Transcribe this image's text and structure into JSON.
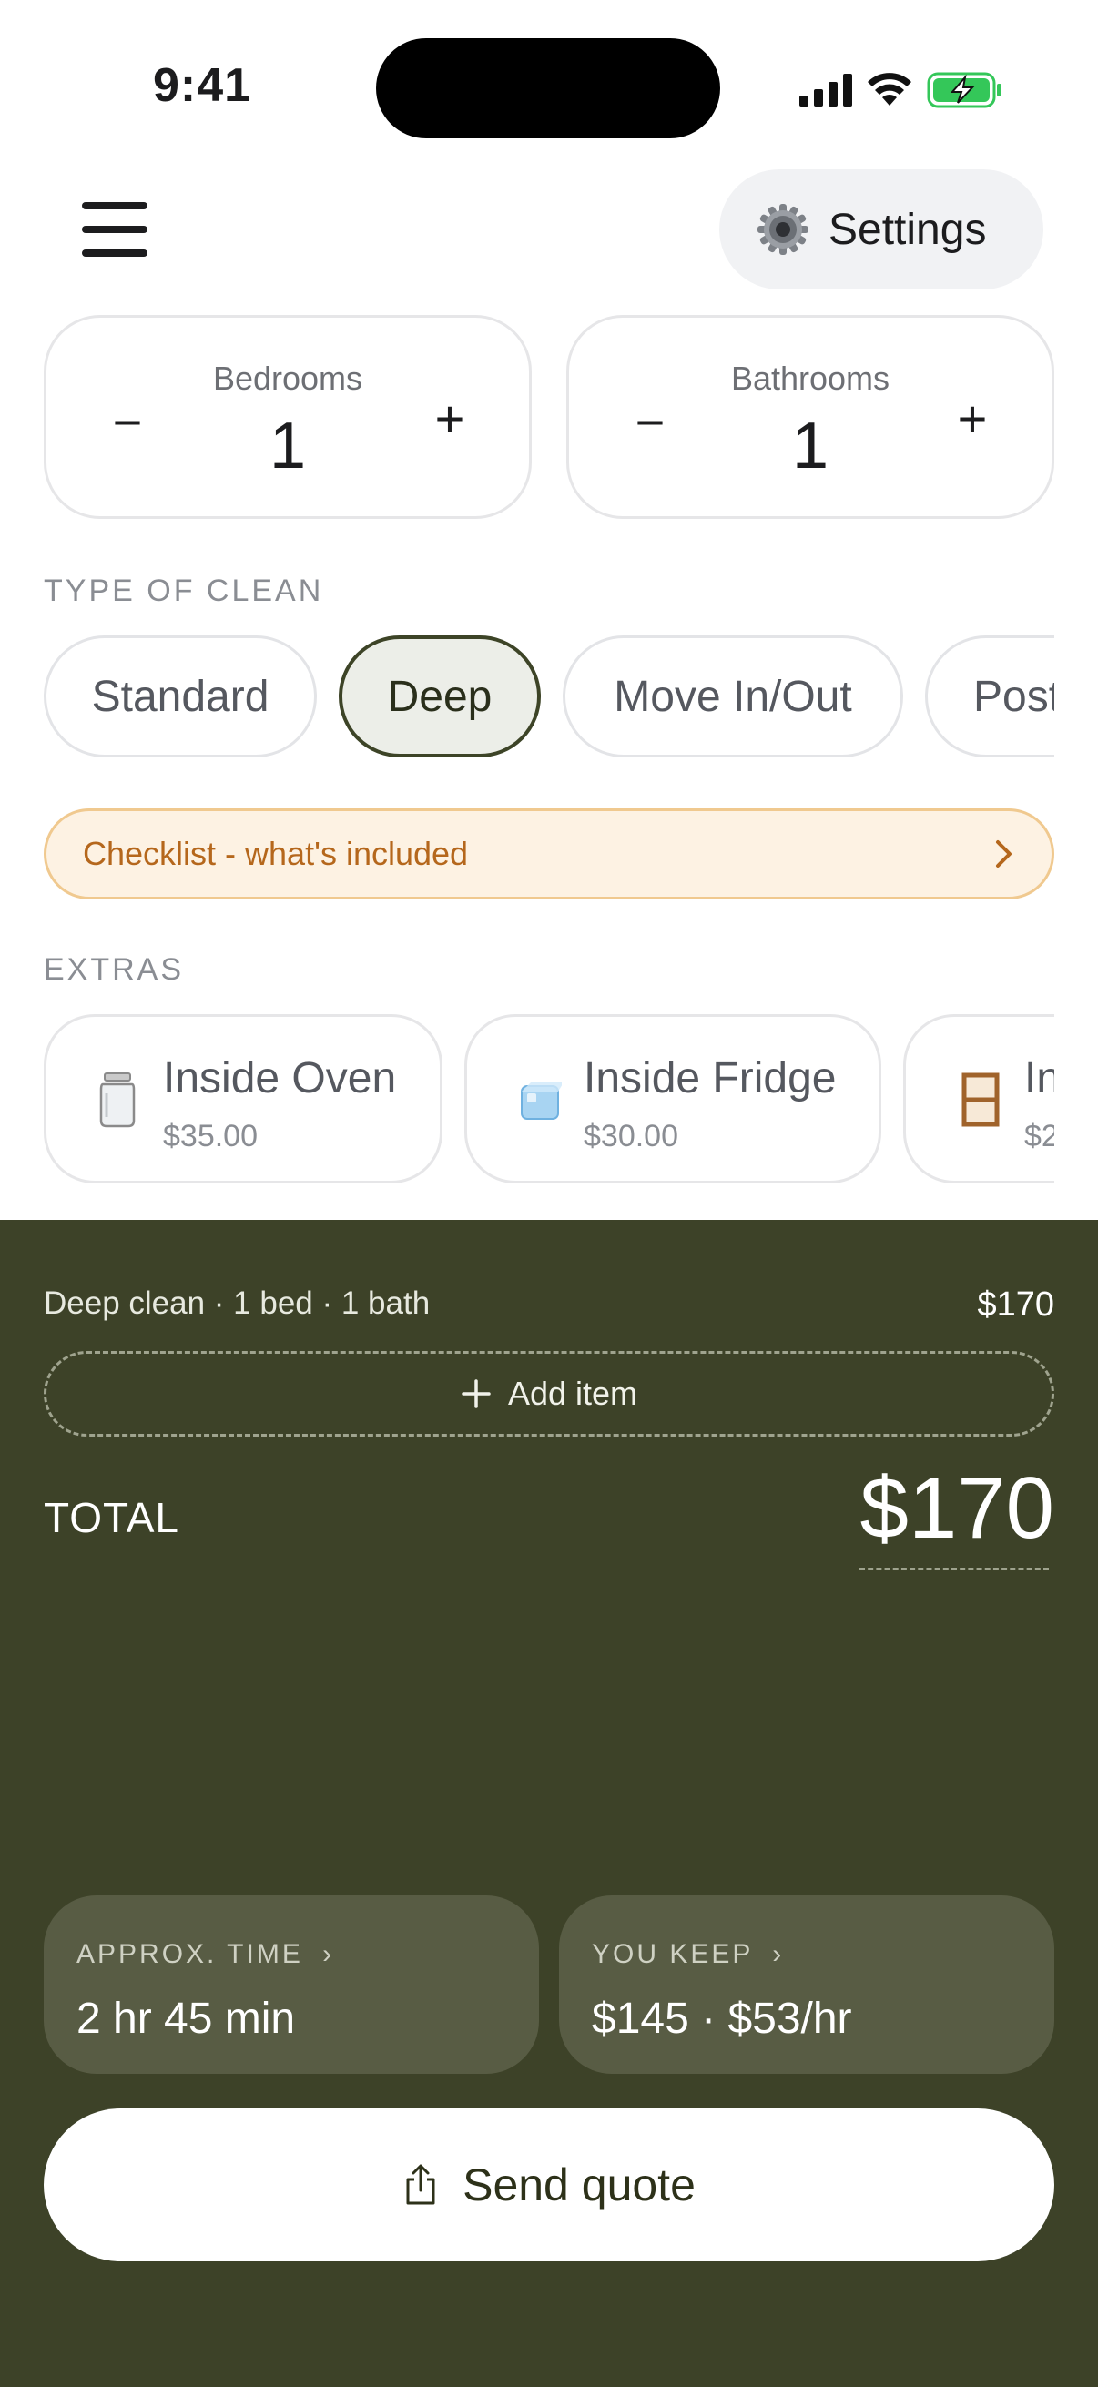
{
  "status_bar": {
    "time": "9:41",
    "battery_color": "#34c759"
  },
  "header": {
    "menu_icon": "hamburger-icon",
    "settings_label": "Settings",
    "settings_icon": "gear-icon"
  },
  "steppers": {
    "bedrooms": {
      "label": "Bedrooms",
      "value": "1",
      "minus": "−",
      "plus": "+"
    },
    "bathrooms": {
      "label": "Bathrooms",
      "value": "1",
      "minus": "−",
      "plus": "+"
    }
  },
  "clean_type": {
    "title": "TYPE OF CLEAN",
    "options": [
      "Standard",
      "Deep",
      "Move In/Out",
      "Post"
    ],
    "selected": "Deep"
  },
  "checklist": {
    "label": "Checklist - what's included",
    "chevron": "›"
  },
  "extras": {
    "title": "EXTRAS",
    "items": [
      {
        "name": "Inside Oven",
        "price": "$35.00",
        "icon": "jar-icon"
      },
      {
        "name": "Inside Fridge",
        "price": "$30.00",
        "icon": "ice-cube-icon"
      },
      {
        "name": "In",
        "price": "$2",
        "icon": "window-icon"
      }
    ]
  },
  "summary": {
    "line_item": "Deep clean · 1 bed · 1 bath",
    "line_price": "$170",
    "add_item_label": "Add item",
    "total_label": "TOTAL",
    "total_value": "$170",
    "time_title": "APPROX. TIME",
    "time_value": "2 hr 45 min",
    "keep_title": "YOU KEEP",
    "keep_value": "$145 · $53/hr",
    "stat_chevron": "›",
    "send_label": "Send quote"
  },
  "colors": {
    "accent_dark": "#3d4228",
    "banner_bg": "#fdf2e3",
    "banner_text": "#b5671c"
  }
}
